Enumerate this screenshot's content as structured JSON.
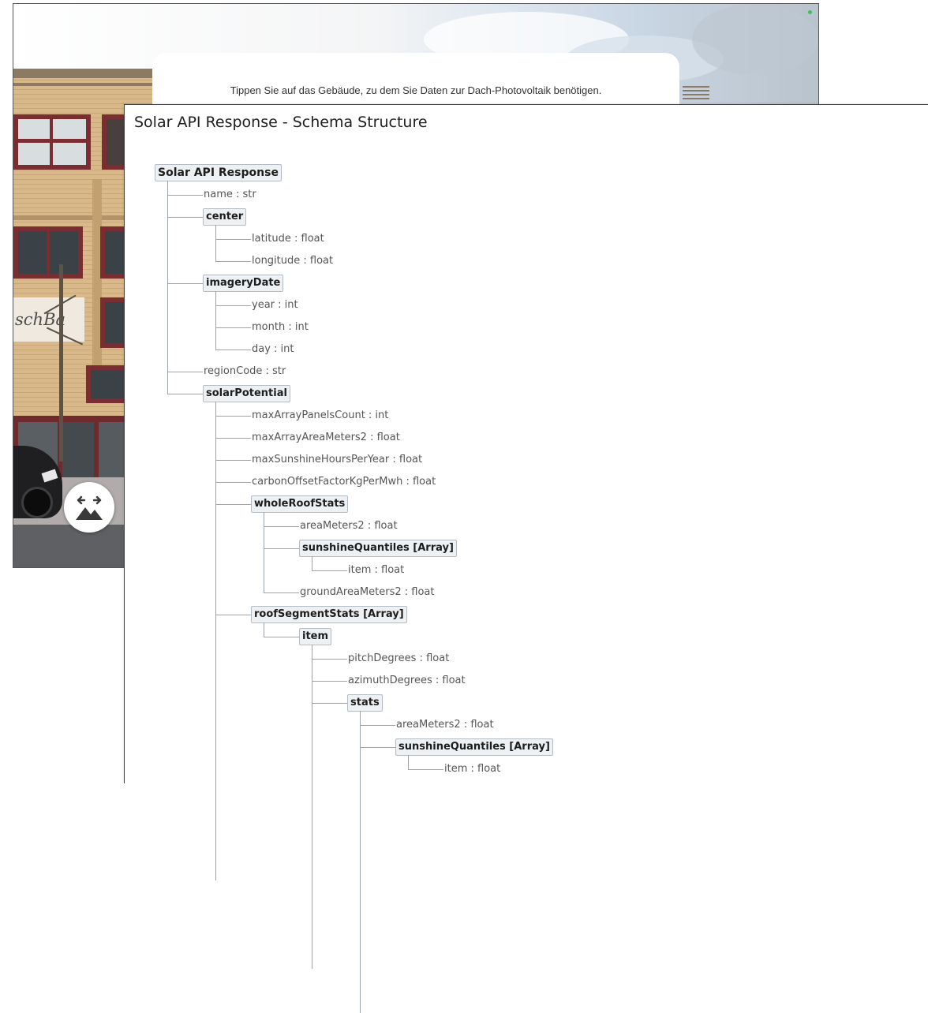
{
  "street_view": {
    "instruction": "Tippen Sie auf das Gebäude, zu dem Sie Daten zur Dach-Photovoltaik benötigen.",
    "storefront_sign": "schBa",
    "toggle_icon": "swap-view-mountain-icon",
    "status_color": "#3cc060"
  },
  "schema_window": {
    "title": "Solar API Response - Schema Structure",
    "tree": {
      "label": "Solar API Response",
      "kind": "object",
      "children": [
        {
          "label": "name : str",
          "kind": "field"
        },
        {
          "label": "center",
          "kind": "object",
          "children": [
            {
              "label": "latitude : float",
              "kind": "field"
            },
            {
              "label": "longitude : float",
              "kind": "field"
            }
          ]
        },
        {
          "label": "imageryDate",
          "kind": "object",
          "children": [
            {
              "label": "year : int",
              "kind": "field"
            },
            {
              "label": "month : int",
              "kind": "field"
            },
            {
              "label": "day : int",
              "kind": "field"
            }
          ]
        },
        {
          "label": "regionCode : str",
          "kind": "field"
        },
        {
          "label": "solarPotential",
          "kind": "object",
          "continues": true,
          "children": [
            {
              "label": "maxArrayPanelsCount : int",
              "kind": "field"
            },
            {
              "label": "maxArrayAreaMeters2 : float",
              "kind": "field"
            },
            {
              "label": "maxSunshineHoursPerYear : float",
              "kind": "field"
            },
            {
              "label": "carbonOffsetFactorKgPerMwh : float",
              "kind": "field"
            },
            {
              "label": "wholeRoofStats",
              "kind": "object",
              "children": [
                {
                  "label": "areaMeters2 : float",
                  "kind": "field"
                },
                {
                  "label": "sunshineQuantiles [Array]",
                  "kind": "object",
                  "children": [
                    {
                      "label": "item : float",
                      "kind": "field"
                    }
                  ]
                },
                {
                  "label": "groundAreaMeters2 : float",
                  "kind": "field"
                }
              ]
            },
            {
              "label": "roofSegmentStats [Array]",
              "kind": "object",
              "children": [
                {
                  "label": "item",
                  "kind": "object",
                  "continues": true,
                  "children": [
                    {
                      "label": "pitchDegrees : float",
                      "kind": "field"
                    },
                    {
                      "label": "azimuthDegrees : float",
                      "kind": "field"
                    },
                    {
                      "label": "stats",
                      "kind": "object",
                      "continues": true,
                      "children": [
                        {
                          "label": "areaMeters2 : float",
                          "kind": "field"
                        },
                        {
                          "label": "sunshineQuantiles [Array]",
                          "kind": "object",
                          "children": [
                            {
                              "label": "item : float",
                              "kind": "field"
                            }
                          ]
                        }
                      ]
                    }
                  ]
                }
              ]
            }
          ]
        }
      ]
    }
  }
}
